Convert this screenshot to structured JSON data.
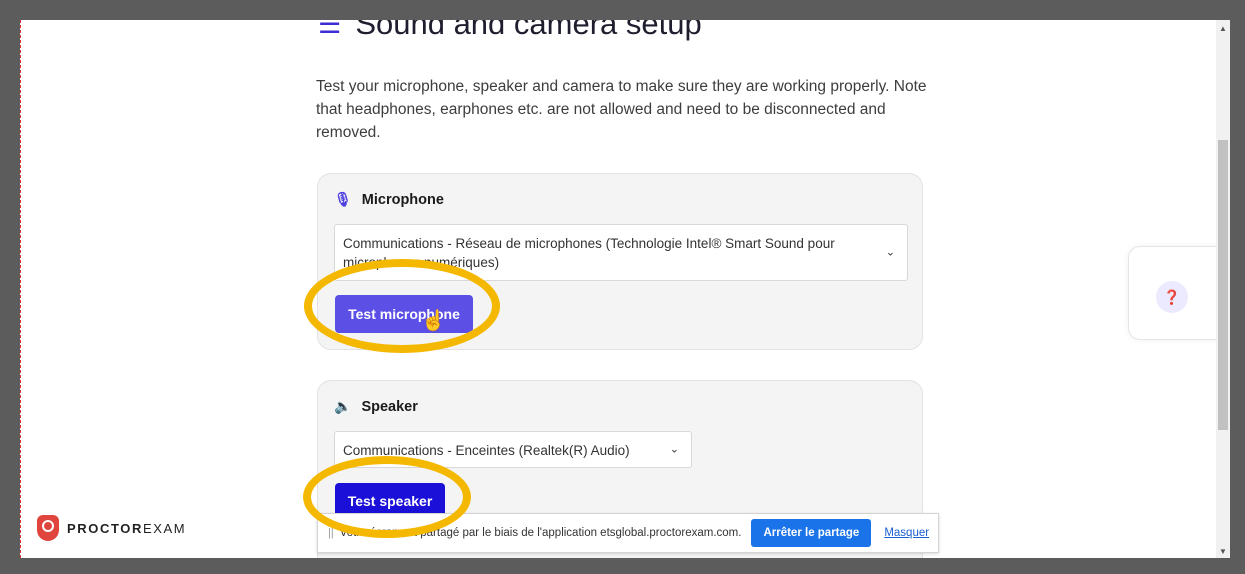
{
  "page": {
    "title": "Sound and camera setup",
    "intro": "Test your microphone, speaker and camera to make sure they are working properly. Note that headphones, earphones etc. are not allowed and need to be disconnected and removed."
  },
  "microphone": {
    "heading": "Microphone",
    "selected_device": "Communications - Réseau de microphones (Technologie Intel® Smart Sound pour microphones numériques)",
    "test_button": "Test microphone"
  },
  "speaker": {
    "heading": "Speaker",
    "selected_device": "Communications - Enceintes (Realtek(R) Audio)",
    "test_button": "Test speaker"
  },
  "help": {
    "icon": "help-icon"
  },
  "logo": {
    "part1": "PROCTOR",
    "part2": "EXAM"
  },
  "share_bar": {
    "message": "Votre écran est partagé par le biais de l'application etsglobal.proctorexam.com.",
    "stop_button": "Arrêter le partage",
    "hide_link": "Masquer"
  },
  "colors": {
    "accent": "#5b4fe6",
    "speaker_button": "#1a10d8",
    "highlight_ring": "#f5b800",
    "share_button": "#1a73e8"
  }
}
